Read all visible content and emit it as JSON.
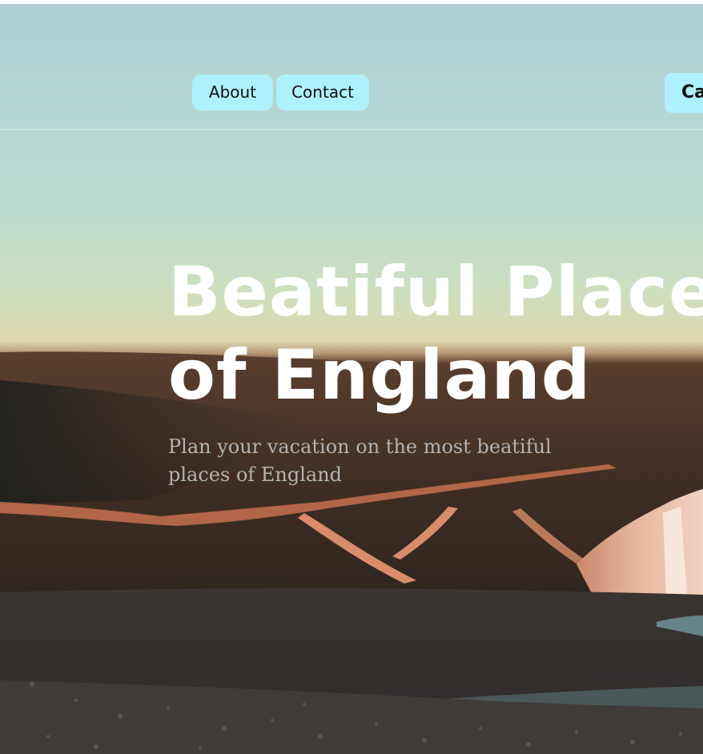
{
  "nav": {
    "items": [
      {
        "label": "About"
      },
      {
        "label": "Contact"
      }
    ],
    "cta_label": "Ca"
  },
  "hero": {
    "title_lines": [
      "Beatiful Places",
      "of England"
    ],
    "subtitle_lines": [
      "Plan your vacation on the most beatiful",
      "places of England"
    ]
  },
  "colors": {
    "nav_button_bg": "#aef0fb",
    "title_text": "#ffffff",
    "subtitle_text": "#b3b3b3"
  }
}
